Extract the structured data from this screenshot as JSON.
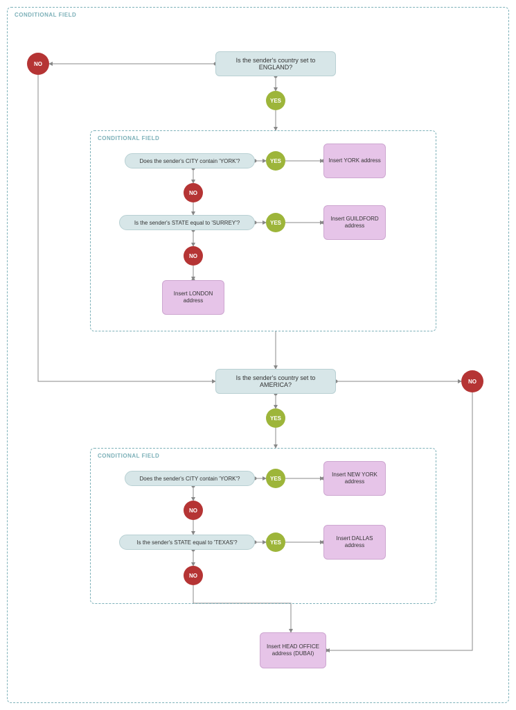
{
  "outer_label": "CONDITIONAL FIELD",
  "q_england": "Is the sender's country set to ENGLAND?",
  "q_america": "Is the sender's country set to AMERICA?",
  "yes": "YES",
  "no": "NO",
  "inner1_label": "CONDITIONAL FIELD",
  "inner2_label": "CONDITIONAL FIELD",
  "q_city_york_1": "Does the sender's CITY contain 'YORK'?",
  "q_state_surrey": "Is the sender's STATE equal to 'SURREY'?",
  "r_york": "Insert YORK address",
  "r_guildford": "Insert GUILDFORD address",
  "r_london": "Insert LONDON address",
  "q_city_york_2": "Does the sender's CITY contain 'YORK'?",
  "q_state_texas": "Is the sender's STATE equal to 'TEXAS'?",
  "r_newyork": "Insert NEW YORK address",
  "r_dallas": "Insert DALLAS address",
  "r_dubai": "Insert HEAD OFFICE address (DUBAI)"
}
